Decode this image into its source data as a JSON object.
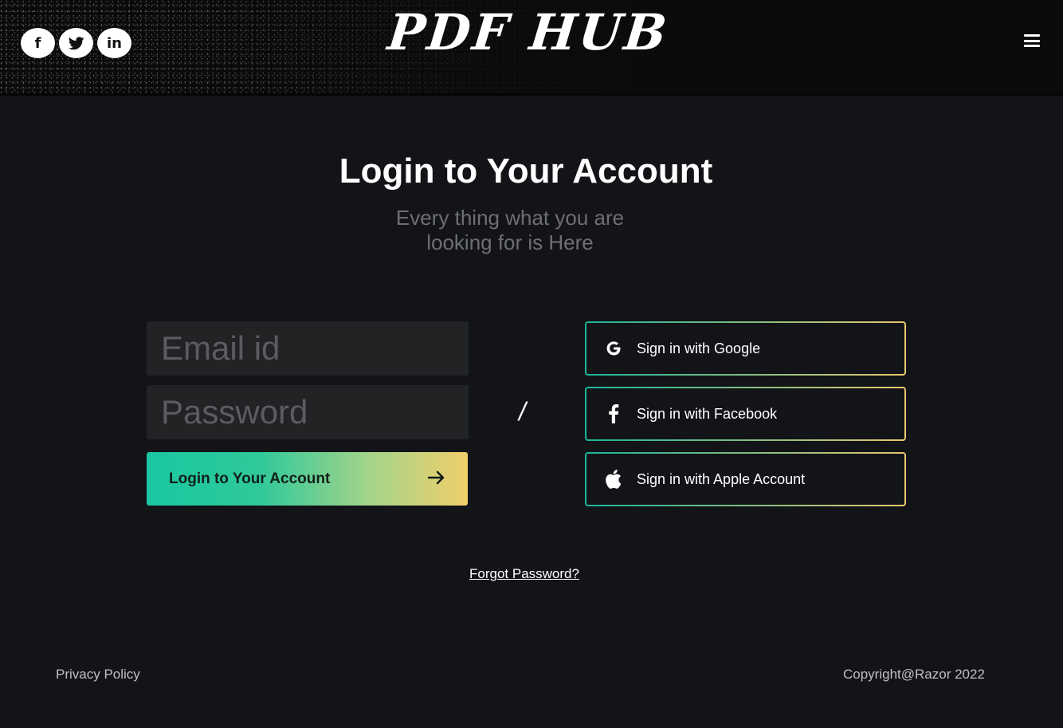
{
  "header": {
    "brand": "PDF HUB",
    "social": [
      {
        "icon": "facebook-icon",
        "glyph": "f"
      },
      {
        "icon": "twitter-icon"
      },
      {
        "icon": "linkedin-icon",
        "glyph": "in"
      }
    ],
    "menu_icon": "hamburger-menu-icon"
  },
  "main": {
    "title": "Login to Your Account",
    "subtitle": "Every thing what you are looking for is Here",
    "email_placeholder": "Email id",
    "password_placeholder": "Password",
    "login_button_label": "Login to Your Account",
    "login_button_icon": "arrow-right-icon",
    "divider": "/",
    "sso": [
      {
        "icon": "google-icon",
        "label": "Sign in with Google"
      },
      {
        "icon": "facebook-icon",
        "label": "Sign in with Facebook"
      },
      {
        "icon": "apple-icon",
        "label": "Sign in with Apple Account"
      }
    ],
    "forgot_password": "Forgot Password?"
  },
  "footer": {
    "privacy": "Privacy Policy",
    "copyright": "Copyright@Razor 2022"
  },
  "colors": {
    "background": "#121418",
    "input_background": "#222325",
    "gradient_start": "#19c7a1",
    "gradient_end": "#f0cf6a"
  }
}
